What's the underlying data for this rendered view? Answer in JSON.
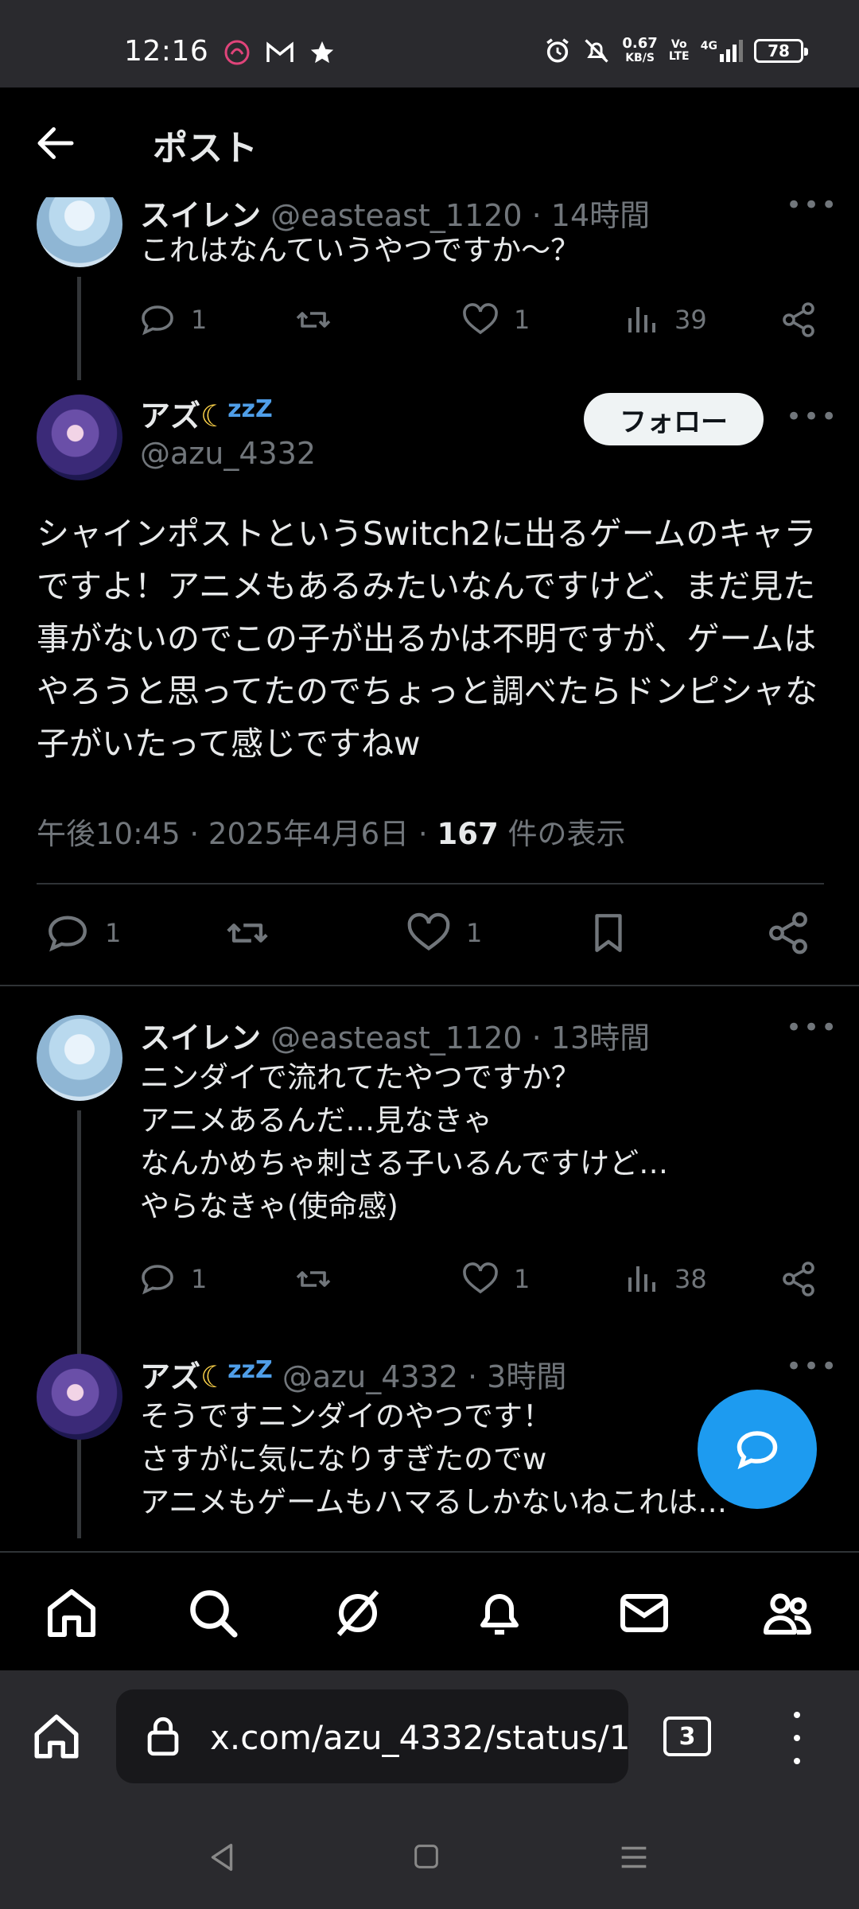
{
  "status_bar": {
    "time": "12:16",
    "net_speed_value": "0.67",
    "net_speed_unit": "KB/S",
    "volte": "Vo LTE",
    "signal": "4G",
    "battery": "78"
  },
  "header": {
    "title": "ポスト"
  },
  "posts": {
    "top_reply": {
      "name": "スイレン",
      "handle": "@easteast_1120 · 14時間",
      "text": "これはなんていうやつですか〜？",
      "reply_count": "1",
      "like_count": "1",
      "view_count": "39"
    },
    "main": {
      "name": "アズ",
      "zzz": "zzZ",
      "handle": "@azu_4332",
      "follow_label": "フォロー",
      "text": "シャインポストというSwitch2に出るゲームのキャラですよ！アニメもあるみたいなんですけど、まだ見た事がないのでこの子が出るかは不明ですが、ゲームはやろうと思ってたのでちょっと調べたらドンピシャな子がいたって感じですねw",
      "time": "午後10:45 · 2025年4月6日 · ",
      "views": "167",
      "views_label": " 件の表示",
      "reply_count": "1",
      "like_count": "1"
    },
    "reply1": {
      "name": "スイレン",
      "handle": "@easteast_1120 · 13時間",
      "text": "ニンダイで流れてたやつですか？\nアニメあるんだ…見なきゃ\nなんかめちゃ刺さる子いるんですけど…\nやらなきゃ(使命感)",
      "reply_count": "1",
      "like_count": "1",
      "view_count": "38"
    },
    "reply2": {
      "name": "アズ",
      "zzz": "zzZ",
      "handle": "@azu_4332 · 3時間",
      "text": "そうですニンダイのやつです！\nさすがに気になりすぎたのでw\nアニメもゲームもハマるしかないねこれは…"
    }
  },
  "browser": {
    "url": "x.com/azu_4332/status/1",
    "tab_count": "3"
  }
}
